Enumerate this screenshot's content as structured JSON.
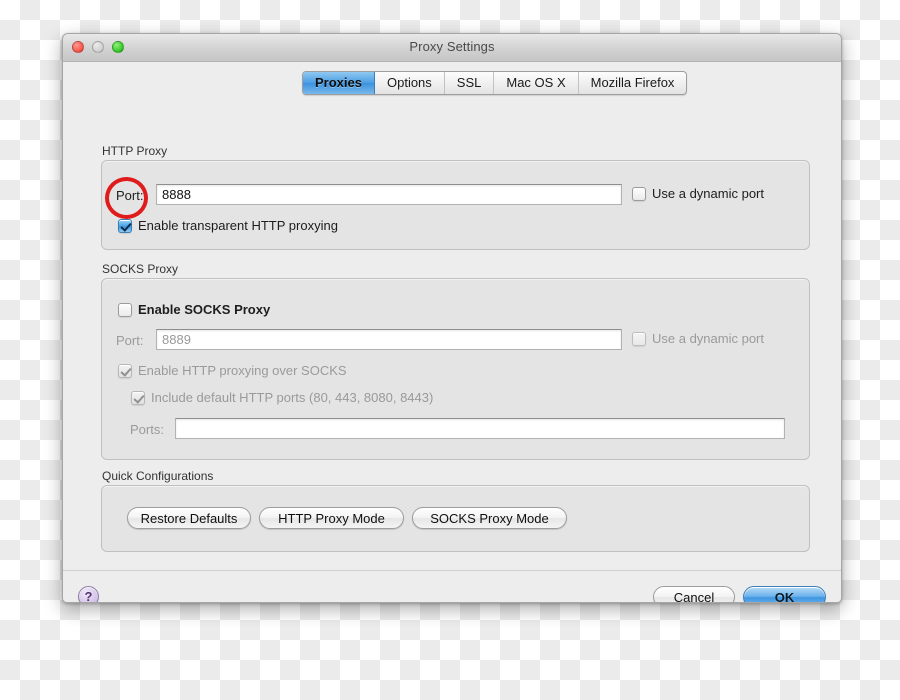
{
  "window": {
    "title": "Proxy Settings",
    "traffic_lights": [
      {
        "name": "close-button",
        "color": "#f6544a"
      },
      {
        "name": "minimize-button",
        "color": "#cfcfcf"
      },
      {
        "name": "zoom-button",
        "color": "#33c627"
      }
    ]
  },
  "tabs": [
    {
      "label": "Proxies",
      "active": true
    },
    {
      "label": "Options",
      "active": false
    },
    {
      "label": "SSL",
      "active": false
    },
    {
      "label": "Mac OS X",
      "active": false
    },
    {
      "label": "Mozilla Firefox",
      "active": false
    }
  ],
  "http_proxy": {
    "group_label": "HTTP Proxy",
    "port_label": "Port:",
    "port_value": "8888",
    "port_placeholder": "",
    "dynamic_port_label": "Use a dynamic port",
    "dynamic_port_checked": false,
    "transparent_label": "Enable transparent HTTP proxying",
    "transparent_checked": true
  },
  "socks_proxy": {
    "group_label": "SOCKS Proxy",
    "enable_label": "Enable SOCKS Proxy",
    "enable_checked": false,
    "port_label": "Port:",
    "port_value": "8889",
    "dynamic_port_label": "Use a dynamic port",
    "dynamic_port_checked": false,
    "http_over_socks_label": "Enable HTTP proxying over SOCKS",
    "http_over_socks_checked": true,
    "default_ports_label": "Include default HTTP ports (80, 443, 8080, 8443)",
    "default_ports_checked": true,
    "ports_label": "Ports:",
    "ports_value": "",
    "ports_placeholder": ""
  },
  "quick_configurations": {
    "group_label": "Quick Configurations",
    "buttons": [
      {
        "label": "Restore Defaults"
      },
      {
        "label": "HTTP Proxy Mode"
      },
      {
        "label": "SOCKS Proxy Mode"
      }
    ]
  },
  "footer": {
    "help_label": "?",
    "cancel_label": "Cancel",
    "ok_label": "OK"
  },
  "annotation": {
    "color": "#e01b1b",
    "target": "transparent-http-proxying-checkbox"
  }
}
